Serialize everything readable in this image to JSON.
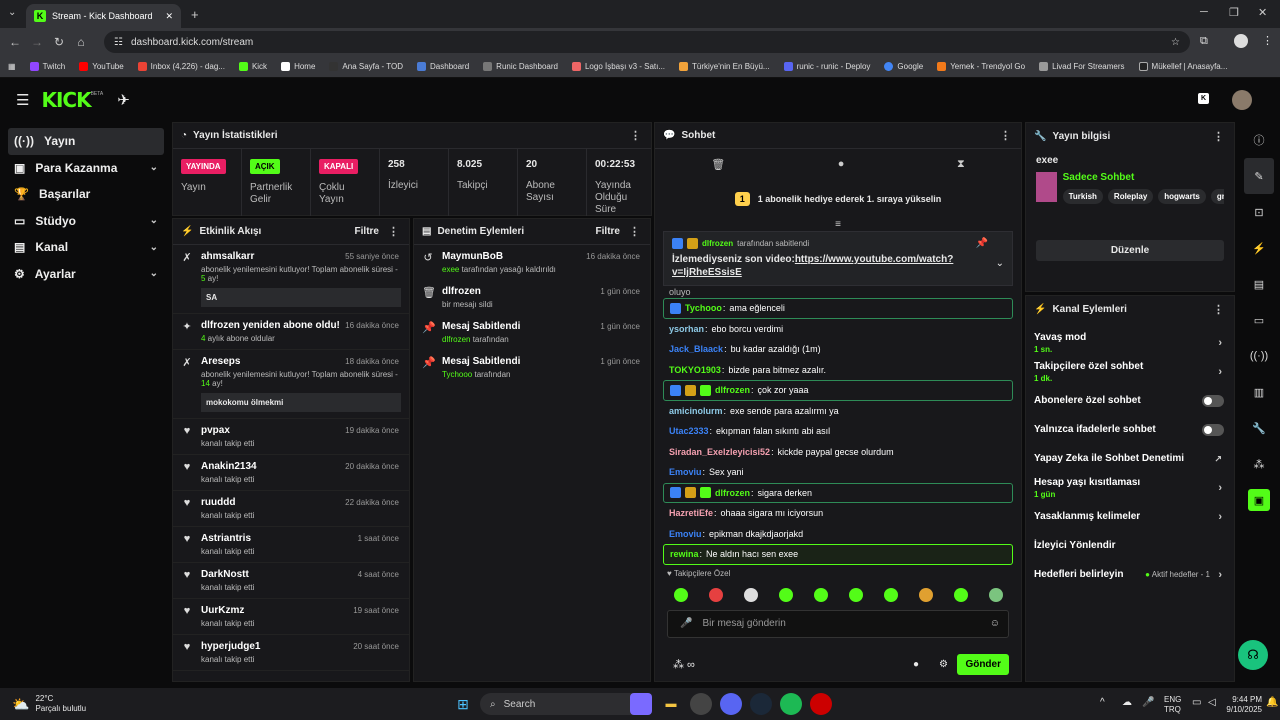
{
  "browser": {
    "tab_title": "Stream - Kick Dashboard",
    "url": "dashboard.kick.com/stream",
    "bookmarks": [
      "Twitch",
      "YouTube",
      "Inbox (4,226) - dag...",
      "Kick",
      "Home",
      "Ana Sayfa - TOD",
      "Dashboard",
      "Runic Dashboard",
      "Logo İşbaşı v3 - Satı...",
      "Türkiye'nin En Büyü...",
      "runic - runic - Deploy",
      "Google",
      "Yemek - Trendyol Go",
      "Livad For Streamers",
      "Mükellef | Anasayfa..."
    ]
  },
  "header": {
    "logo": "KICK",
    "beta": "BETA"
  },
  "nav": [
    {
      "label": "Yayın",
      "icon": "broadcast-icon",
      "chev": ""
    },
    {
      "label": "Para Kazanma",
      "icon": "money-icon",
      "chev": "⌄"
    },
    {
      "label": "Başarılar",
      "icon": "trophy-icon",
      "chev": ""
    },
    {
      "label": "Stüdyo",
      "icon": "studio-icon",
      "chev": "⌄"
    },
    {
      "label": "Kanal",
      "icon": "channel-icon",
      "chev": "⌄"
    },
    {
      "label": "Ayarlar",
      "icon": "gear-icon",
      "chev": "⌄"
    }
  ],
  "stats": {
    "title": "Yayın İstatistikleri",
    "items": [
      {
        "badge": "YAYINDA",
        "color": "#e91e63",
        "label": "Yayın"
      },
      {
        "badge": "AÇIK",
        "color": "#53fc18",
        "label": "Partnerlik Gelir"
      },
      {
        "badge": "KAPALI",
        "color": "#e91e63",
        "label": "Çoklu Yayın"
      },
      {
        "value": "258",
        "label": "İzleyici"
      },
      {
        "value": "8.025",
        "label": "Takipçi"
      },
      {
        "value": "20",
        "label": "Abone Sayısı"
      },
      {
        "value": "00:22:53",
        "label": "Yayında Olduğu Süre"
      }
    ]
  },
  "activity": {
    "title": "Etkinlik Akışı",
    "filter": "Filtre",
    "events": [
      {
        "name": "ahmsalkarr",
        "time": "55 saniye önce",
        "sub_a": "abonelik yenilemesini kutluyor! Toplam abonelik süresi - ",
        "n": "5",
        "sub_b": " ay!",
        "msg": "SA",
        "icon": "resub-icon"
      },
      {
        "name": "dlfrozen yeniden abone oldu!",
        "time": "16 dakika önce",
        "n": "4",
        "sub_b": " aylık abone oldular",
        "icon": "sparkle-icon"
      },
      {
        "name": "Areseps",
        "time": "18 dakika önce",
        "sub_a": "abonelik yenilemesini kutluyor! Toplam abonelik süresi - ",
        "n": "14",
        "sub_b": " ay!",
        "msg": "mokokomu ölmekmi",
        "icon": "resub-icon"
      },
      {
        "name": "pvpax",
        "time": "19 dakika önce",
        "sub": "kanalı takip etti"
      },
      {
        "name": "Anakin2134",
        "time": "20 dakika önce",
        "sub": "kanalı takip etti"
      },
      {
        "name": "ruuddd",
        "time": "22 dakika önce",
        "sub": "kanalı takip etti"
      },
      {
        "name": "Astriantris",
        "time": "1 saat önce",
        "sub": "kanalı takip etti"
      },
      {
        "name": "DarkNostt",
        "time": "4 saat önce",
        "sub": "kanalı takip etti"
      },
      {
        "name": "UurKzmz",
        "time": "19 saat önce",
        "sub": "kanalı takip etti"
      },
      {
        "name": "hyperjudge1",
        "time": "20 saat önce",
        "sub": "kanalı takip etti"
      }
    ]
  },
  "moderation": {
    "title": "Denetim Eylemleri",
    "filter": "Filtre",
    "events": [
      {
        "name": "MaymunBoB",
        "time": "16 dakika önce",
        "actor": "exee",
        "sub": " tarafından yasağı kaldırıldı",
        "icon": "unban-icon",
        "glyph": "↺"
      },
      {
        "name": "dlfrozen",
        "time": "1 gün önce",
        "actor": "",
        "sub": "bir mesajı sildi",
        "icon": "trash-icon",
        "glyph": "🗑"
      },
      {
        "name": "Mesaj Sabitlendi",
        "time": "1 gün önce",
        "actor": "dlfrozen",
        "sub": " tarafından",
        "icon": "pin-icon",
        "glyph": "📌"
      },
      {
        "name": "Mesaj Sabitlendi",
        "time": "1 gün önce",
        "actor": "Tychooo",
        "sub": " tarafından",
        "icon": "pin-icon",
        "glyph": "📌"
      }
    ]
  },
  "chat": {
    "title": "Sohbet",
    "promo": "1 abonelik hediye ederek 1. sıraya yükselin",
    "promo_badge": "1",
    "pinned_by": "dlfrozen",
    "pinned_by_sfx": " tarafından sabitlendi",
    "pinned_text": "İzlemediyseniz son video:",
    "pinned_link": "https://www.youtube.com/watch?v=IjRheESsisE",
    "partial": "oluyo",
    "messages": [
      {
        "user": "Tychooo",
        "color": "#53fc18",
        "text": "ama eğlenceli",
        "style": "hl2",
        "badges": [
          "#3b82f6"
        ]
      },
      {
        "user": "ysorhan",
        "color": "#8ecae6",
        "text": "ebo borcu verdimi"
      },
      {
        "user": "Jack_Blaack",
        "color": "#3b82f6",
        "text": "bu kadar azaldığı (1m)"
      },
      {
        "user": "TOKYO1903",
        "color": "#53fc18",
        "text": "bizde para bitmez azalır."
      },
      {
        "user": "dlfrozen",
        "color": "#53fc18",
        "text": "çok zor yaaa",
        "style": "hl2",
        "badges": [
          "#3b82f6",
          "#d4a017",
          "#53fc18"
        ]
      },
      {
        "user": "amicinolurm",
        "color": "#8ecae6",
        "text": "exe sende para azalırmı ya"
      },
      {
        "user": "Utac2333",
        "color": "#3b82f6",
        "text": "ekıpman falan sıkıntı abi asıl"
      },
      {
        "user": "Siradan_Exelzleyicisi52",
        "color": "#f4a0b0",
        "text": "kickde paypal gecse olurdum"
      },
      {
        "user": "Emoviu",
        "color": "#3b82f6",
        "text": "Sex yani"
      },
      {
        "user": "dlfrozen",
        "color": "#53fc18",
        "text": "sigara derken",
        "style": "hl2",
        "badges": [
          "#3b82f6",
          "#d4a017",
          "#53fc18"
        ]
      },
      {
        "user": "HazretiEfe",
        "color": "#f4a0b0",
        "text": "ohaaa sigara mı iciyorsun"
      },
      {
        "user": "Emoviu",
        "color": "#3b82f6",
        "text": "epikman dkajkdjaorjakd"
      },
      {
        "user": "rewina",
        "color": "#53fc18",
        "text": "Ne aldın hacı sen exee",
        "style": "hl"
      }
    ],
    "followers_only": "Takipçilere Özel",
    "placeholder": "Bir mesaj gönderin",
    "send": "Gönder"
  },
  "stream_info": {
    "title": "Yayın bilgisi",
    "stream_title": "exee",
    "category": "Sadece Sohbet",
    "tags": [
      "Turkish",
      "Roleplay",
      "hogwarts",
      "gm"
    ],
    "edit": "Düzenle"
  },
  "channel_actions": {
    "title": "Kanal Eylemleri",
    "items": [
      {
        "label": "Yavaş mod",
        "sub": "1 sn.",
        "ctrl": "chev"
      },
      {
        "label": "Takipçilere özel sohbet",
        "sub": "1 dk.",
        "ctrl": "chev"
      },
      {
        "label": "Abonelere özel sohbet",
        "sub": "",
        "ctrl": "toggle"
      },
      {
        "label": "Yalnızca ifadelerle sohbet",
        "sub": "",
        "ctrl": "toggle"
      },
      {
        "label": "Yapay Zeka ile Sohbet Denetimi",
        "sub": "",
        "ctrl": "ext"
      },
      {
        "label": "Hesap yaşı kısıtlaması",
        "sub": "1 gün",
        "ctrl": "chev"
      },
      {
        "label": "Yasaklanmış kelimeler",
        "sub": "",
        "ctrl": "chev"
      },
      {
        "label": "İzleyici Yönlendir",
        "sub": "",
        "ctrl": ""
      },
      {
        "label": "Hedefleri belirleyin",
        "sub": "",
        "ctrl": "chev",
        "extra": "Aktif hedefler - 1"
      }
    ]
  },
  "taskbar": {
    "temp": "22°C",
    "weather": "Parçalı bulutlu",
    "search": "Search",
    "lang1": "ENG",
    "lang2": "TRQ",
    "time": "9:44 PM",
    "date": "9/10/2025"
  },
  "colors": {
    "accent": "#53fc18",
    "live": "#e91e63"
  }
}
